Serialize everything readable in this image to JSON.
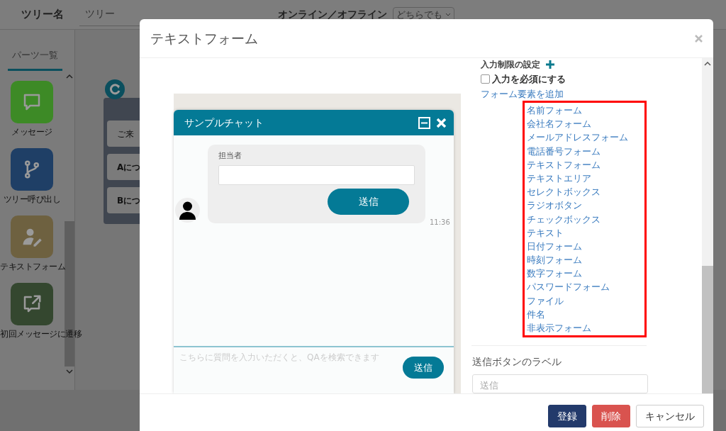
{
  "header": {
    "tree_name_label": "ツリー名",
    "tree_name_value": "ツリー",
    "status_label": "オンライン／オフライン",
    "status_select": "どちらでも"
  },
  "sidebar": {
    "tab": {
      "label": "パーツ一覧",
      "selected": true
    },
    "parts": [
      {
        "label": "メッセージ",
        "kind": "message",
        "color": "#3d8a26"
      },
      {
        "label": "ツリー呼び出し",
        "kind": "branch",
        "color": "#1f3f66"
      },
      {
        "label": "テキストフォーム",
        "kind": "form",
        "color": "#6e6140"
      },
      {
        "label": "初回メッセージに遷移",
        "kind": "jump",
        "color": "#34472f"
      }
    ]
  },
  "canvas": {
    "node_buttons": [
      {
        "label": "ご来",
        "bold": false
      },
      {
        "label": "Aにつ",
        "bold": true
      },
      {
        "label": "Bにつ",
        "bold": true
      }
    ]
  },
  "modal": {
    "title": "テキストフォーム",
    "preview": {
      "title": "サンプルチャット",
      "field_label": "担当者",
      "send_button": "送信",
      "time": "11:36",
      "input_placeholder": "こちらに質問を入力いただくと、QAを検索できます",
      "input_send_button": "送信"
    },
    "settings": {
      "restriction_label": "入力制限の設定",
      "required": {
        "label": "入力を必須にする",
        "checked": false
      },
      "add_link": "フォーム要素を追加",
      "form_elements": [
        "名前フォーム",
        "会社名フォーム",
        "メールアドレスフォーム",
        "電話番号フォーム",
        "テキストフォーム",
        "テキストエリア",
        "セレクトボックス",
        "ラジオボタン",
        "チェックボックス",
        "テキスト",
        "日付フォーム",
        "時刻フォーム",
        "数字フォーム",
        "パスワードフォーム",
        "ファイル",
        "件名",
        "非表示フォーム"
      ],
      "button_label_heading": "送信ボタンのラベル",
      "button_label_placeholder": "送信"
    },
    "footer_buttons": [
      {
        "label": "登録",
        "kind": "primary"
      },
      {
        "label": "削除",
        "kind": "danger"
      },
      {
        "label": "キャンセル",
        "kind": "default"
      }
    ]
  }
}
